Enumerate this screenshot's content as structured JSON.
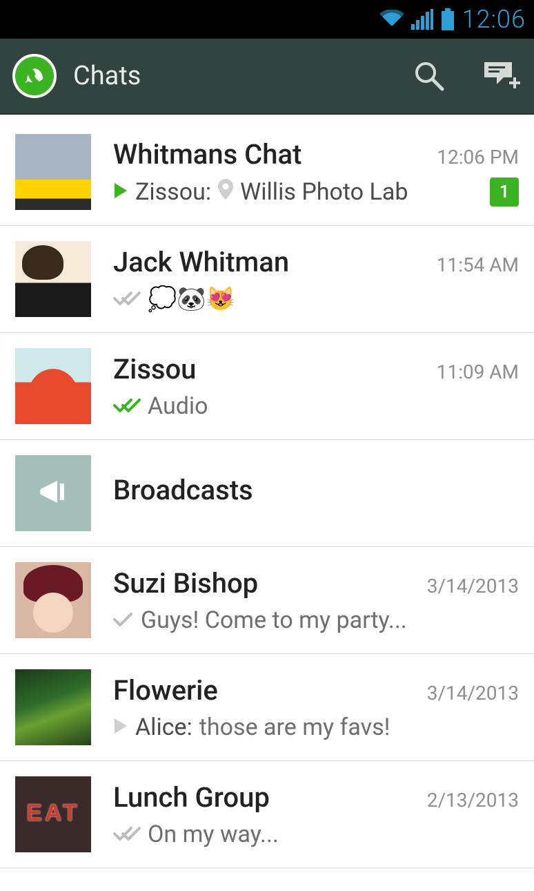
{
  "status": {
    "time": "12:06"
  },
  "header": {
    "title": "Chats"
  },
  "chats": [
    {
      "name": "Whitmans Chat",
      "time": "12:06 PM",
      "prefix_icon": "play-green",
      "sender": "Zissou:",
      "loc_icon": true,
      "text": "Willis Photo Lab",
      "unread": "1",
      "avatar": "av1"
    },
    {
      "name": "Jack Whitman",
      "time": "11:54 AM",
      "tick": "double-gray",
      "text": "💭🐼😻",
      "avatar": "av2"
    },
    {
      "name": "Zissou",
      "time": "11:09 AM",
      "tick": "double-green",
      "text": "Audio",
      "avatar": "av3"
    },
    {
      "name": "Broadcasts",
      "broadcast": true
    },
    {
      "name": "Suzi Bishop",
      "time": "3/14/2013",
      "tick": "single-gray",
      "text": "Guys! Come to my party...",
      "avatar": "av5"
    },
    {
      "name": "Flowerie",
      "time": "3/14/2013",
      "prefix_icon": "play-gray",
      "sender": "Alice:",
      "text": "those are my favs!",
      "avatar": "av6"
    },
    {
      "name": "Lunch Group",
      "time": "2/13/2013",
      "tick": "double-gray",
      "text": "On my way...",
      "avatar": "av7"
    }
  ]
}
